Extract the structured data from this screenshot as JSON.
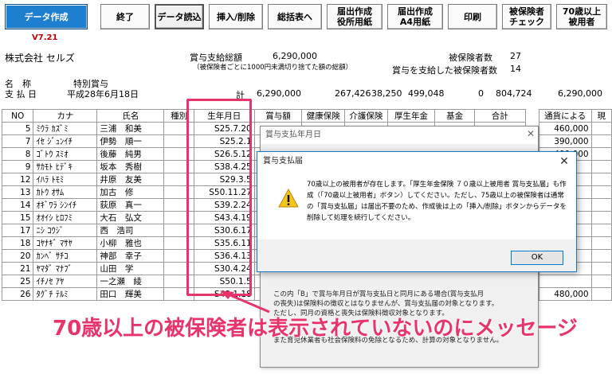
{
  "toolbar": {
    "buttons": [
      "データ作成",
      "終了",
      "データ読込",
      "挿入/削除",
      "総括表へ",
      "届出作成\n役所用紙",
      "届出作成\nA4用紙",
      "印刷",
      "被保険者\nチェック",
      "70歳以上\n被用者"
    ],
    "version": "V7.21"
  },
  "header": {
    "company": "株式会社 セルズ",
    "name_label": "名　称",
    "name_value": "特別賞与",
    "payday_label": "支 払 日",
    "payday_value": "平成28年6月18日",
    "total_label": "賞与支給総額",
    "total_value": "6,290,000",
    "total_note": "（被保険者ごとに1000円未満切り捨てた額の総額）",
    "insured_count_label": "被保険者数",
    "insured_count": "27",
    "bonus_paid_label": "賞与を支給した被保険者数",
    "bonus_paid_count": "14",
    "sum_label": "計",
    "sums": [
      "6,290,000",
      "267,426",
      "38,250",
      "499,048",
      "0",
      "804,724",
      "6,290,000"
    ]
  },
  "table": {
    "headers": [
      "NO",
      "カナ",
      "氏名",
      "種別",
      "生年月日",
      "賞与額",
      "健康保険",
      "介護保険",
      "厚生年金",
      "基金",
      "合計",
      "",
      "通貨による",
      "現"
    ],
    "rows": [
      {
        "no": "5",
        "kana": "ﾐｳﾗ ｶｽﾞﾐ",
        "name": "三浦　和美",
        "birth": "S25.7.20",
        "right": "460,000"
      },
      {
        "no": "7",
        "kana": "ｲｾ ｼﾞｭﾝｲﾁ",
        "name": "伊勢　順一",
        "birth": "S25.2.1",
        "right": "390,000"
      },
      {
        "no": "8",
        "kana": "ｺﾞﾄｳ ｽﾐｵ",
        "name": "後藤　純男",
        "birth": "S26.5.12",
        "right": "400,000"
      },
      {
        "no": "9",
        "kana": "ｻｶﾓﾄ ﾋﾃﾞｷ",
        "name": "坂本　秀樹",
        "birth": "S38.4.25",
        "right": ""
      },
      {
        "no": "12",
        "kana": "ｲﾊﾗ ﾄﾓﾐ",
        "name": "井原　友美",
        "birth": "S29.3.5",
        "right": ""
      },
      {
        "no": "13",
        "kana": "ｶﾄｳ ｵｻﾑ",
        "name": "加古　修",
        "birth": "S50.11.27",
        "right": ""
      },
      {
        "no": "14",
        "kana": "ｵｷﾞﾜﾗ ｼﾝｲﾁ",
        "name": "荻原　真一",
        "birth": "S39.2.24",
        "right": ""
      },
      {
        "no": "15",
        "kana": "ｵｵｲｼ ﾋﾛﾌﾐ",
        "name": "大石　弘文",
        "birth": "S43.4.19",
        "right": ""
      },
      {
        "no": "17",
        "kana": "ﾆｼ ｺｳｼﾞ",
        "name": "西　浩司",
        "birth": "S30.6.17",
        "right": ""
      },
      {
        "no": "18",
        "kana": "ｺﾔﾅｷﾞ ﾏｻﾔ",
        "name": "小柳　雅也",
        "birth": "S35.6.11",
        "right": ""
      },
      {
        "no": "20",
        "kana": "ｶﾝﾍﾞ ｻﾁｺ",
        "name": "神部　幸子",
        "birth": "S36.4.13",
        "right": ""
      },
      {
        "no": "21",
        "kana": "ﾔﾏﾀﾞ ﾏﾅﾌﾞ",
        "name": "山田　学",
        "birth": "S30.4.24",
        "right": ""
      },
      {
        "no": "25",
        "kana": "ｲﾁﾉｾ ｱﾔ",
        "name": "一之瀬　綾",
        "birth": "S50.1.5",
        "right": ""
      },
      {
        "no": "26",
        "kana": "ﾀｸﾞﾁ ﾃﾙﾐ",
        "name": "田口　輝美",
        "birth": "S48.1.18",
        "right": "480,000"
      }
    ]
  },
  "back_window": {
    "title": "賞与支払年月日",
    "notes": [
      "この内「B」で賞与年月日が賞与支払日と同月にある場合(賞与支払月",
      "の喪失)は保険料の徴収とはなりませんが、賞与支払届の対象となります。",
      "ただし、同月の資格と喪失は保険料徴収対象となります。",
      "また育児休業者も社会保険料の免除となるため、計算の対象となりません。"
    ]
  },
  "dialog": {
    "title": "賞与支払届",
    "message": "70歳以上の被用者が存在します。「厚生年金保険 ７０歳以上被用者 賞与支払届」も作成（「70歳以上被用者」ボタン）してください。ただし、75歳以上の被保険者は通常の「賞与支払届」は届出不要のため、作成後は上の「挿入/削除」ボタンからデータを削除して処理を続行してください。",
    "ok_label": "OK",
    "close_label": "✕"
  },
  "annotation": {
    "caption": "70歳以上の被保険者は表示されていないのにメッセージ",
    "colors": {
      "highlight": "#e8336b",
      "caption": "#e8336b"
    }
  }
}
